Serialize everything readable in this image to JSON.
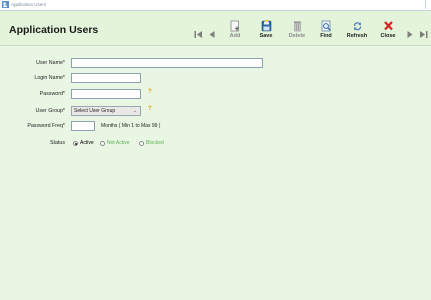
{
  "window": {
    "title": "Application Users"
  },
  "header": {
    "title": "Application Users"
  },
  "toolbar": {
    "add_label": "Add",
    "save_label": "Save",
    "delete_label": "Delete",
    "find_label": "Find",
    "refresh_label": "Refresh",
    "close_label": "Close",
    "icons": [
      "first-icon",
      "previous-icon",
      "add-icon",
      "save-icon",
      "delete-icon",
      "find-icon",
      "refresh-icon",
      "close-icon",
      "next-icon",
      "last-icon"
    ]
  },
  "form": {
    "user_name": {
      "label": "User Name*",
      "value": ""
    },
    "login_name": {
      "label": "Login Name*",
      "value": ""
    },
    "password": {
      "label": "Password*",
      "value": "",
      "hint": "?"
    },
    "user_group": {
      "label": "User Group*",
      "selected": "Select User Group",
      "hint": "?"
    },
    "password_freq": {
      "label": "Password Freq*",
      "value": "",
      "note": "Months ( Min 1 to Max 99 )"
    },
    "status": {
      "label": "Status",
      "options": [
        "Active",
        "Not Active",
        "Blocked"
      ],
      "selected": "Active"
    }
  },
  "colors": {
    "background": "#eaf6e4",
    "header": "#e3f4da",
    "hint": "#e0a100",
    "inactive_option": "#5fae54",
    "close": "#d62020"
  }
}
